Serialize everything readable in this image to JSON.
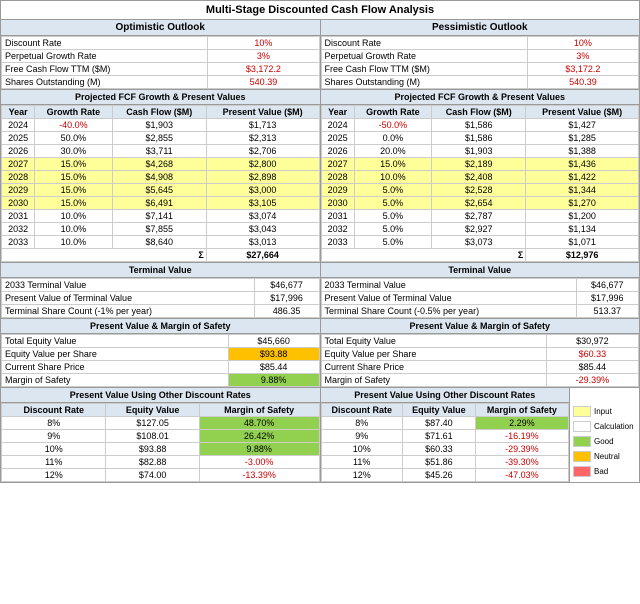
{
  "title": "Multi-Stage Discounted Cash Flow Analysis",
  "optimistic": {
    "label": "Optimistic Outlook",
    "params": [
      {
        "name": "Discount Rate",
        "value": "10%"
      },
      {
        "name": "Perpetual Growth Rate",
        "value": "3%"
      },
      {
        "name": "Free Cash Flow TTM ($M)",
        "value": "$3,172.2"
      },
      {
        "name": "Shares Outstanding (M)",
        "value": "540.39"
      }
    ],
    "fcf_title": "Projected FCF Growth & Present Values",
    "fcf_headers": [
      "Year",
      "Growth Rate",
      "Cash Flow ($M)",
      "Present Value ($M)"
    ],
    "fcf_rows": [
      {
        "year": "2024",
        "growth": "-40.0%",
        "cashflow": "$1,903",
        "pv": "$1,713",
        "highlight": ""
      },
      {
        "year": "2025",
        "growth": "50.0%",
        "cashflow": "$2,855",
        "pv": "$2,313",
        "highlight": ""
      },
      {
        "year": "2026",
        "growth": "30.0%",
        "cashflow": "$3,711",
        "pv": "$2,706",
        "highlight": ""
      },
      {
        "year": "2027",
        "growth": "15.0%",
        "cashflow": "$4,268",
        "pv": "$2,800",
        "highlight": "yellow"
      },
      {
        "year": "2028",
        "growth": "15.0%",
        "cashflow": "$4,908",
        "pv": "$2,898",
        "highlight": "yellow"
      },
      {
        "year": "2029",
        "growth": "15.0%",
        "cashflow": "$5,645",
        "pv": "$3,000",
        "highlight": "yellow"
      },
      {
        "year": "2030",
        "growth": "15.0%",
        "cashflow": "$6,491",
        "pv": "$3,105",
        "highlight": "yellow"
      },
      {
        "year": "2031",
        "growth": "10.0%",
        "cashflow": "$7,141",
        "pv": "$3,074",
        "highlight": ""
      },
      {
        "year": "2032",
        "growth": "10.0%",
        "cashflow": "$7,855",
        "pv": "$3,043",
        "highlight": ""
      },
      {
        "year": "2033",
        "growth": "10.0%",
        "cashflow": "$8,640",
        "pv": "$3,013",
        "highlight": ""
      }
    ],
    "fcf_sum": "$27,664",
    "terminal": {
      "title": "Terminal Value",
      "rows": [
        {
          "name": "2033 Terminal Value",
          "value": "$46,677"
        },
        {
          "name": "Present Value of Terminal Value",
          "value": "$17,996"
        },
        {
          "name": "Terminal Share Count (-1% per year)",
          "value": "486.35"
        }
      ]
    },
    "pv": {
      "title": "Present Value & Margin of Safety",
      "rows": [
        {
          "name": "Total Equity Value",
          "value": "$45,660",
          "color": ""
        },
        {
          "name": "Equity Value per Share",
          "value": "$93.88",
          "color": "orange"
        },
        {
          "name": "Current Share Price",
          "value": "$85.44",
          "color": ""
        },
        {
          "name": "Margin of Safety",
          "value": "9.88%",
          "color": "green"
        }
      ]
    },
    "discount_rates": {
      "title": "Present Value Using Other Discount Rates",
      "headers": [
        "Discount Rate",
        "Equity Value",
        "Margin of Safety"
      ],
      "rows": [
        {
          "rate": "8%",
          "equity": "$127.05",
          "margin": "48.70%",
          "margin_color": "green"
        },
        {
          "rate": "9%",
          "equity": "$108.01",
          "margin": "26.42%",
          "margin_color": "green"
        },
        {
          "rate": "10%",
          "equity": "$93.88",
          "margin": "9.88%",
          "margin_color": "green"
        },
        {
          "rate": "11%",
          "equity": "$82.88",
          "margin": "-3.00%",
          "margin_color": "red"
        },
        {
          "rate": "12%",
          "equity": "$74.00",
          "margin": "-13.39%",
          "margin_color": "red"
        }
      ]
    }
  },
  "pessimistic": {
    "label": "Pessimistic Outlook",
    "params": [
      {
        "name": "Discount Rate",
        "value": "10%"
      },
      {
        "name": "Perpetual Growth Rate",
        "value": "3%"
      },
      {
        "name": "Free Cash Flow TTM ($M)",
        "value": "$3,172.2"
      },
      {
        "name": "Shares Outstanding (M)",
        "value": "540.39"
      }
    ],
    "fcf_title": "Projected FCF Growth & Present Values",
    "fcf_headers": [
      "Year",
      "Growth Rate",
      "Cash Flow ($M)",
      "Present Value ($M)"
    ],
    "fcf_rows": [
      {
        "year": "2024",
        "growth": "-50.0%",
        "cashflow": "$1,586",
        "pv": "$1,427",
        "highlight": ""
      },
      {
        "year": "2025",
        "growth": "0.0%",
        "cashflow": "$1,586",
        "pv": "$1,285",
        "highlight": ""
      },
      {
        "year": "2026",
        "growth": "20.0%",
        "cashflow": "$1,903",
        "pv": "$1,388",
        "highlight": ""
      },
      {
        "year": "2027",
        "growth": "15.0%",
        "cashflow": "$2,189",
        "pv": "$1,436",
        "highlight": "yellow"
      },
      {
        "year": "2028",
        "growth": "10.0%",
        "cashflow": "$2,408",
        "pv": "$1,422",
        "highlight": "yellow"
      },
      {
        "year": "2029",
        "growth": "5.0%",
        "cashflow": "$2,528",
        "pv": "$1,344",
        "highlight": "yellow"
      },
      {
        "year": "2030",
        "growth": "5.0%",
        "cashflow": "$2,654",
        "pv": "$1,270",
        "highlight": "yellow"
      },
      {
        "year": "2031",
        "growth": "5.0%",
        "cashflow": "$2,787",
        "pv": "$1,200",
        "highlight": ""
      },
      {
        "year": "2032",
        "growth": "5.0%",
        "cashflow": "$2,927",
        "pv": "$1,134",
        "highlight": ""
      },
      {
        "year": "2033",
        "growth": "5.0%",
        "cashflow": "$3,073",
        "pv": "$1,071",
        "highlight": ""
      }
    ],
    "fcf_sum": "$12,976",
    "terminal": {
      "title": "Terminal Value",
      "rows": [
        {
          "name": "2033 Terminal Value",
          "value": "$46,677"
        },
        {
          "name": "Present Value of Terminal Value",
          "value": "$17,996"
        },
        {
          "name": "Terminal Share Count (-0.5% per year)",
          "value": "513.37"
        }
      ]
    },
    "pv": {
      "title": "Present Value & Margin of Safety",
      "rows": [
        {
          "name": "Total Equity Value",
          "value": "$30,972",
          "color": ""
        },
        {
          "name": "Equity Value per Share",
          "value": "$60.33",
          "color": "red"
        },
        {
          "name": "Current Share Price",
          "value": "$85.44",
          "color": ""
        },
        {
          "name": "Margin of Safety",
          "value": "-29.39%",
          "color": "red"
        }
      ]
    },
    "discount_rates": {
      "title": "Present Value Using Other Discount Rates",
      "headers": [
        "Discount Rate",
        "Equity Value",
        "Margin of Safety"
      ],
      "rows": [
        {
          "rate": "8%",
          "equity": "$87.40",
          "margin": "2.29%",
          "margin_color": "green"
        },
        {
          "rate": "9%",
          "equity": "$71.61",
          "margin": "-16.19%",
          "margin_color": "red"
        },
        {
          "rate": "10%",
          "equity": "$60.33",
          "margin": "-29.39%",
          "margin_color": "red"
        },
        {
          "rate": "11%",
          "equity": "$51.86",
          "margin": "-39.30%",
          "margin_color": "red"
        },
        {
          "rate": "12%",
          "equity": "$45.26",
          "margin": "-47.03%",
          "margin_color": "red"
        }
      ]
    }
  },
  "legend": {
    "items": [
      {
        "label": "Input",
        "color": "#ffff99"
      },
      {
        "label": "Calculation",
        "color": "#ffffff"
      },
      {
        "label": "Good",
        "color": "#92d050"
      },
      {
        "label": "Neutral",
        "color": "#ffc000"
      },
      {
        "label": "Bad",
        "color": "#ff6666"
      }
    ]
  }
}
